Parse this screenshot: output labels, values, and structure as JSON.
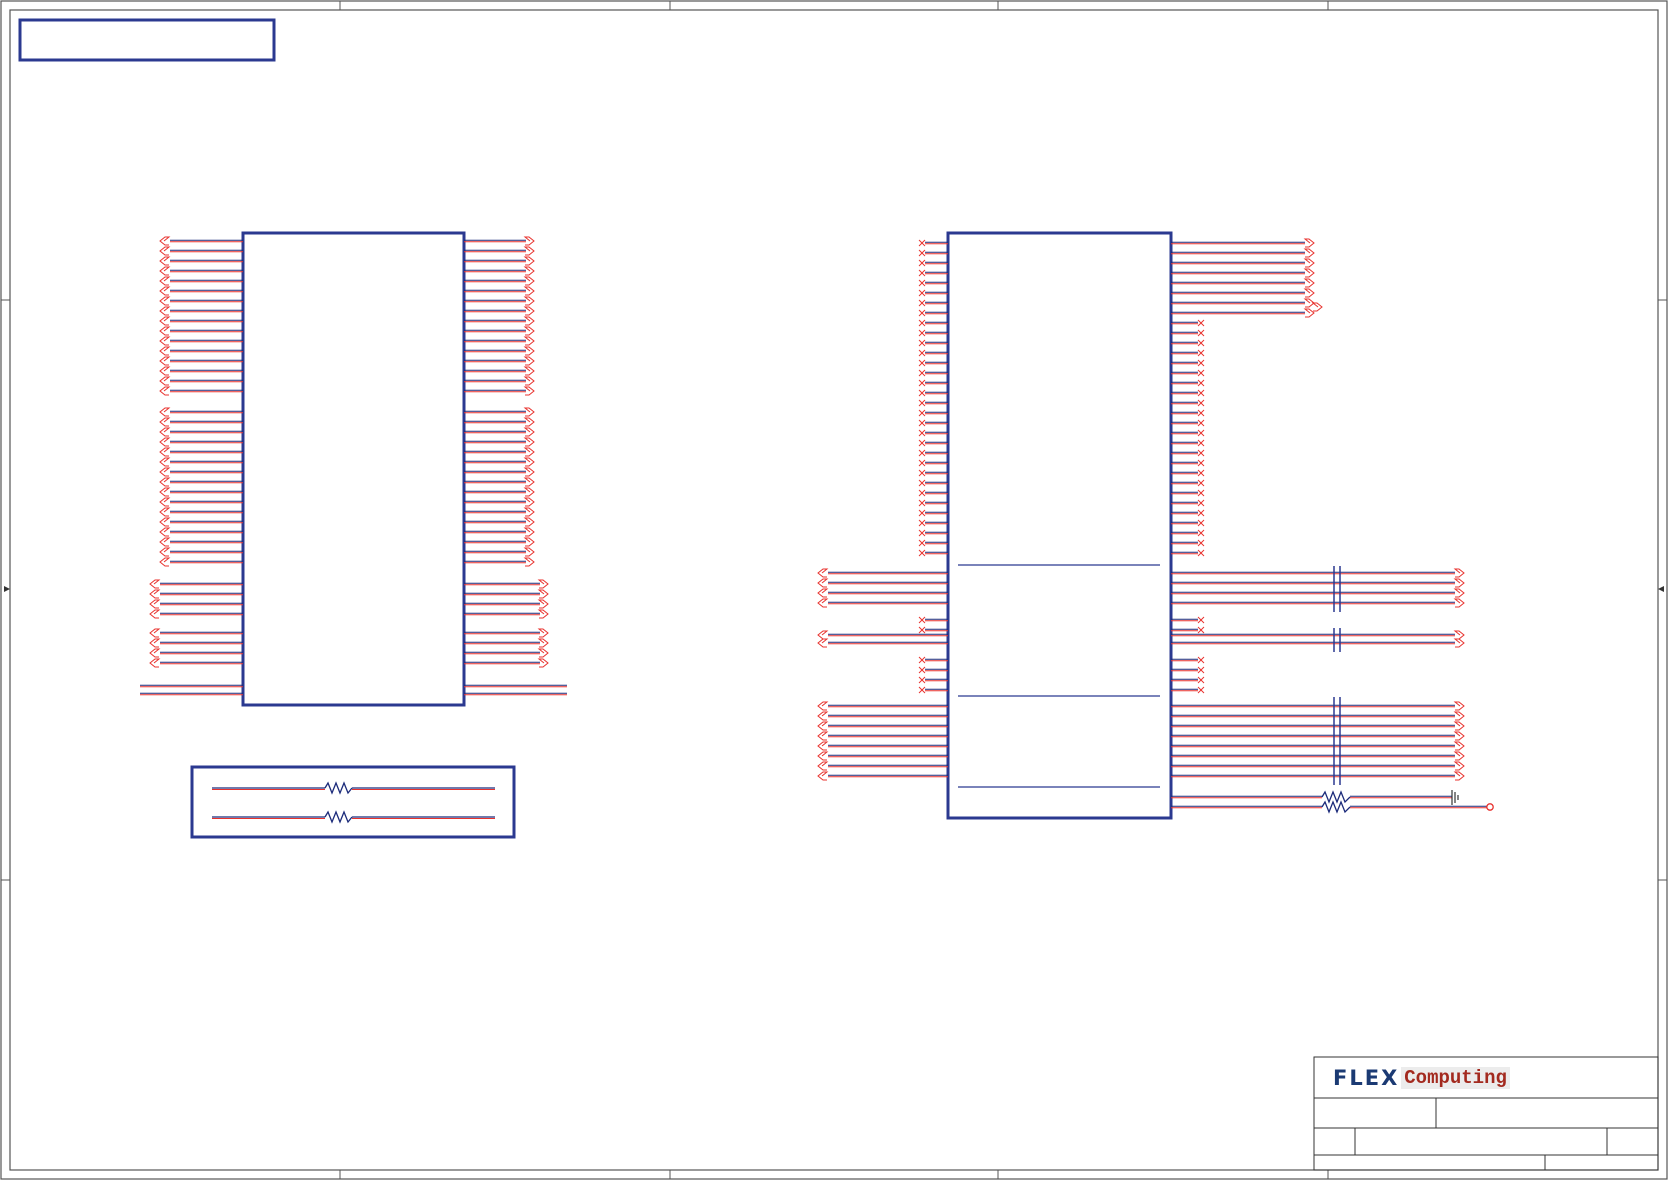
{
  "title_block": {
    "logo_part1": "FLEX",
    "logo_part2": "Computing"
  },
  "colors": {
    "frame": "#333333",
    "part_outline": "#2b3990",
    "net_wire": "#e8322e",
    "bus_wire": "#1b2a7a",
    "logo_blue": "#1b3a73",
    "logo_red": "#a32a1f"
  }
}
